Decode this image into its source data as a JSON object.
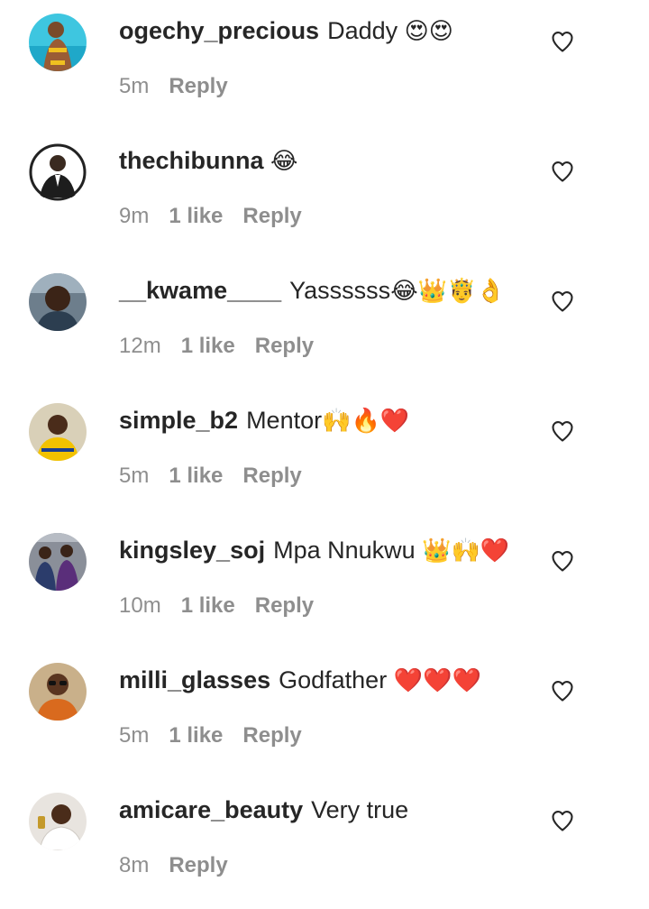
{
  "colors": {
    "text": "#262626",
    "meta": "#8e8e8e",
    "background": "#ffffff",
    "heart_outline": "#262626",
    "emoji_heart": "#e0245e"
  },
  "comments": [
    {
      "username": "ogechy_precious",
      "text": "Daddy",
      "emoji": "😍😍",
      "time": "5m",
      "likes": "",
      "reply": "Reply",
      "avatar": "avatar-photo-woman-pool"
    },
    {
      "username": "thechibunna",
      "text": "",
      "emoji": "😂",
      "time": "9m",
      "likes": "1 like",
      "reply": "Reply",
      "avatar": "avatar-photo-man-suit"
    },
    {
      "username": "__kwame____",
      "text": "Yassssss",
      "emoji": "😂👑🤴👌",
      "time": "12m",
      "likes": "1 like",
      "reply": "Reply",
      "avatar": "avatar-photo-man-car"
    },
    {
      "username": "simple_b2",
      "text": "Mentor",
      "emoji": "🙌🔥❤️",
      "time": "5m",
      "likes": "1 like",
      "reply": "Reply",
      "avatar": "avatar-photo-man-hivis"
    },
    {
      "username": "kingsley_soj",
      "text": "Mpa Nnukwu",
      "emoji": "👑🙌❤️",
      "time": "10m",
      "likes": "1 like",
      "reply": "Reply",
      "avatar": "avatar-photo-group"
    },
    {
      "username": "milli_glasses",
      "text": "Godfather",
      "emoji": "❤️❤️❤️",
      "time": "5m",
      "likes": "1 like",
      "reply": "Reply",
      "avatar": "avatar-photo-man-glasses"
    },
    {
      "username": "amicare_beauty",
      "text": "Very true",
      "emoji": "",
      "time": "8m",
      "likes": "",
      "reply": "Reply",
      "avatar": "avatar-photo-woman-white"
    }
  ]
}
